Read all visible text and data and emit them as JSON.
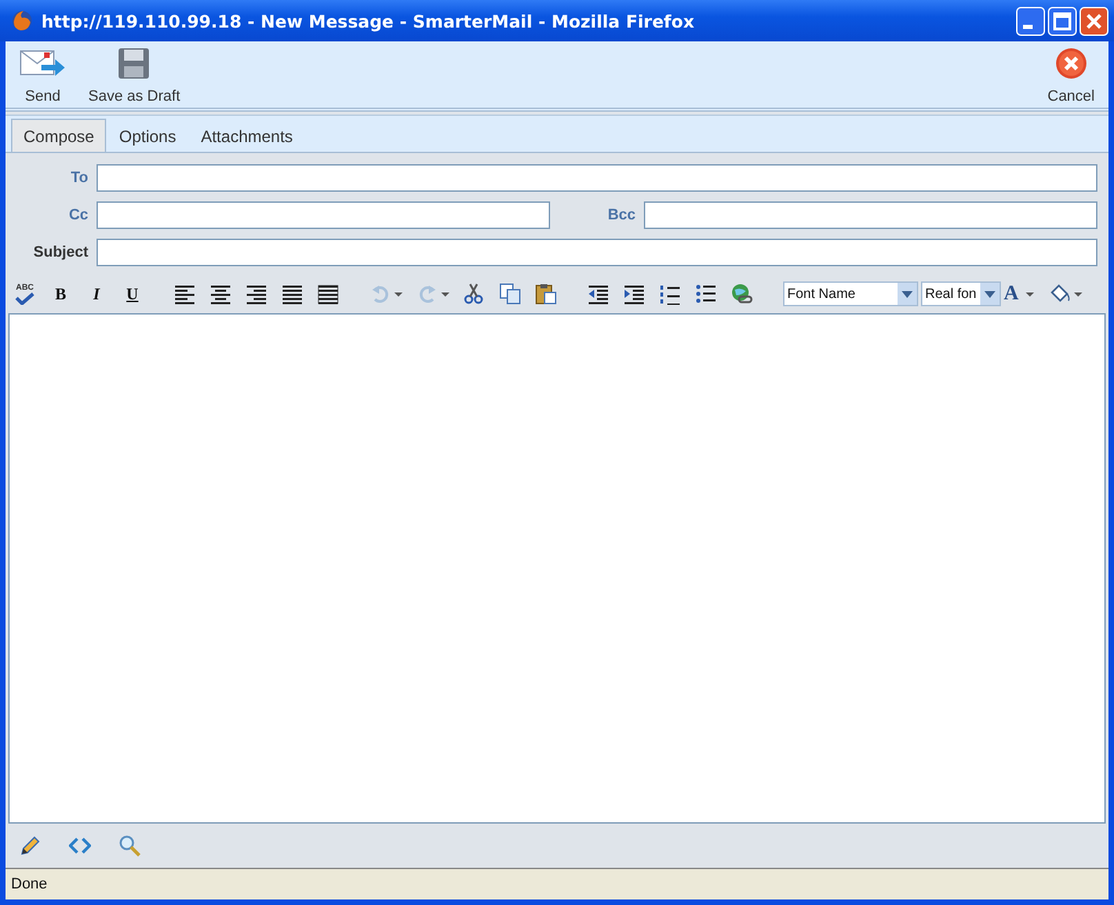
{
  "window": {
    "title": "http://119.110.99.18 - New Message - SmarterMail - Mozilla Firefox"
  },
  "toolbar": {
    "left": [
      {
        "kind": "send",
        "label": "Send"
      },
      {
        "kind": "draft",
        "label": "Save as Draft"
      }
    ],
    "right": [
      {
        "kind": "cancel",
        "label": "Cancel"
      }
    ]
  },
  "tabs": [
    {
      "label": "Compose",
      "selected": true
    },
    {
      "label": "Options",
      "selected": false
    },
    {
      "label": "Attachments",
      "selected": false
    }
  ],
  "fields": [
    {
      "label": "To",
      "kind": "address"
    },
    {
      "label": "Cc",
      "kind": "address"
    },
    {
      "label": "Bcc",
      "kind": "address"
    },
    {
      "label": "Subject",
      "kind": "text"
    }
  ],
  "editor_toolbar": {
    "spellcheck_label": "ABC",
    "format_buttons": [
      "B",
      "I",
      "U"
    ],
    "history_buttons": [
      {
        "kind": "undo",
        "disabled": true
      },
      {
        "kind": "redo",
        "disabled": true
      }
    ],
    "font_name": "Font Name",
    "font_size": "Real fon",
    "font_color_label": "A"
  },
  "status_bar": {
    "text": "Done"
  }
}
